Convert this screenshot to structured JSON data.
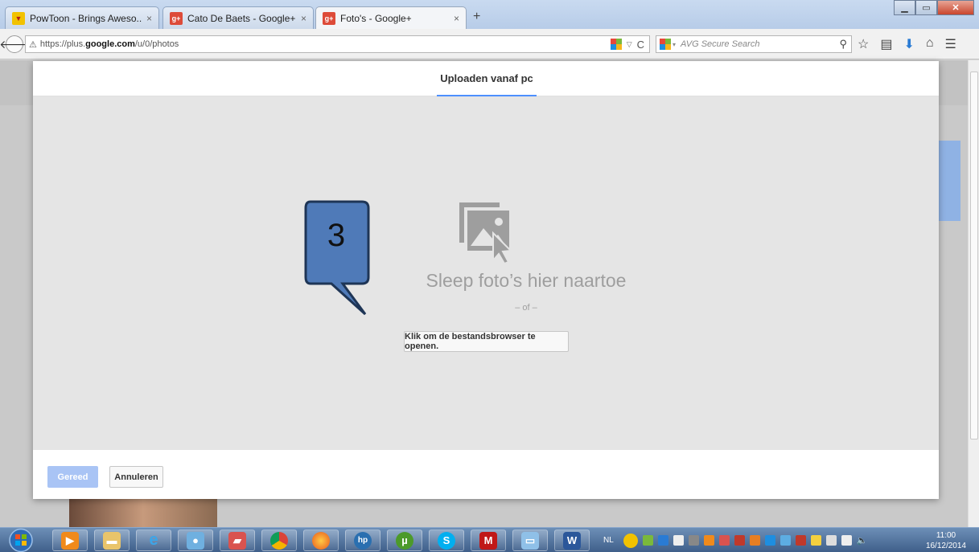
{
  "browser": {
    "tabs": [
      {
        "label": "PowToon - Brings Aweso...",
        "favicon": "powtoon-icon",
        "active": false
      },
      {
        "label": "Cato De Baets - Google+",
        "favicon": "google-plus-icon",
        "active": false
      },
      {
        "label": "Foto's - Google+",
        "favicon": "google-plus-icon",
        "active": true
      }
    ],
    "new_tab_symbol": "+",
    "tab_close_symbol": "×",
    "url_prefix": "https://plus.",
    "url_domain": "google.com",
    "url_path": "/u/0/photos",
    "search_placeholder": "AVG Secure Search"
  },
  "dialog": {
    "tab_label": "Uploaden vanaf pc",
    "drop_text": "Sleep foto’s hier naartoe",
    "or_text": "– of –",
    "browse_button": "Klik om de bestandsbrowser te openen.",
    "done_button": "Gereed",
    "cancel_button": "Annuleren"
  },
  "callout": {
    "number": "3",
    "color": "#4f7ab8"
  },
  "colors": {
    "accent": "#4d90fe",
    "done_button_bg": "#a9c4f5"
  },
  "taskbar": {
    "language": "NL",
    "time": "11:00",
    "date": "16/12/2014",
    "apps": [
      "media-player-icon",
      "file-explorer-icon",
      "internet-explorer-icon",
      "camera-app-icon",
      "folder-app-icon",
      "chrome-icon",
      "firefox-icon",
      "hp-icon",
      "utorrent-icon",
      "skype-icon",
      "mcafee-icon",
      "paint-icon",
      "word-icon"
    ]
  }
}
